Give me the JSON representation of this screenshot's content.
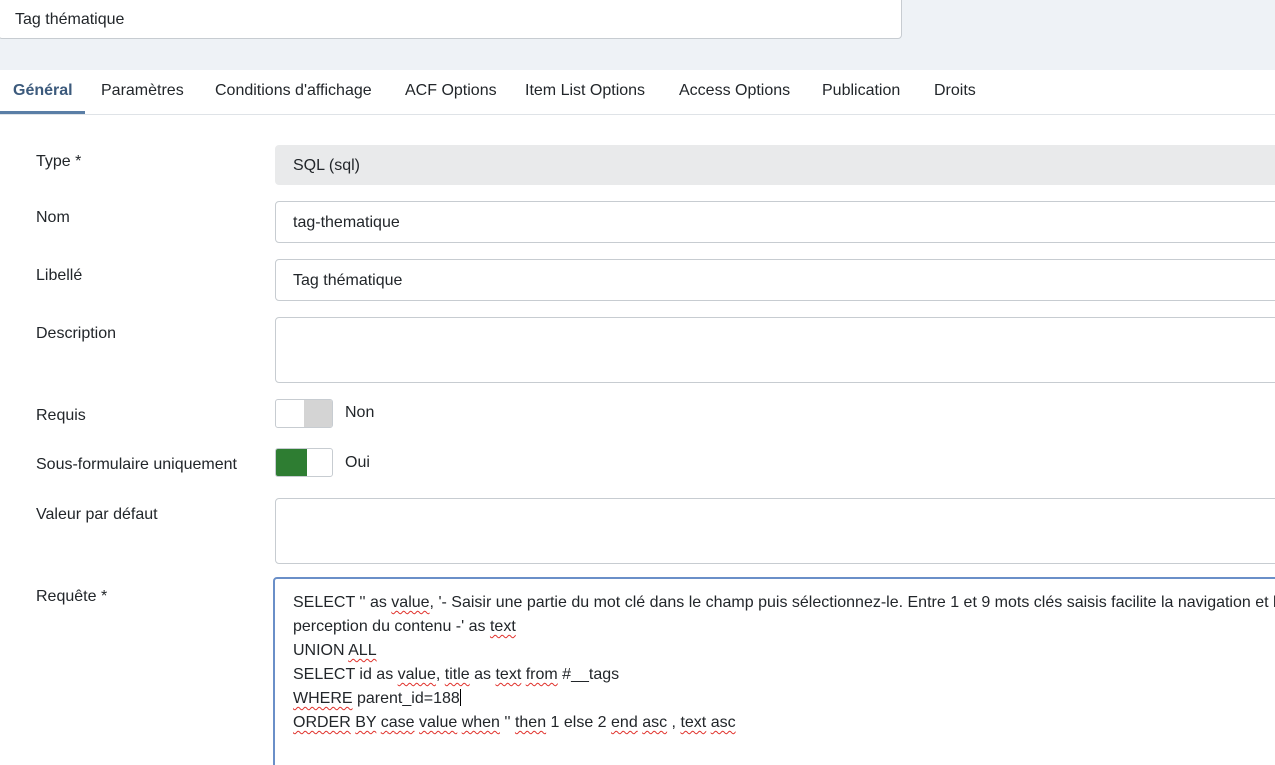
{
  "header": {
    "title_value": "Tag thématique"
  },
  "tabs": [
    {
      "label": "Général",
      "active": true
    },
    {
      "label": "Paramètres"
    },
    {
      "label": "Conditions d'affichage"
    },
    {
      "label": "ACF Options"
    },
    {
      "label": "Item List Options"
    },
    {
      "label": "Access Options"
    },
    {
      "label": "Publication"
    },
    {
      "label": "Droits"
    }
  ],
  "form": {
    "type": {
      "label": "Type *",
      "value": "SQL (sql)"
    },
    "name": {
      "label": "Nom",
      "value": "tag-thematique"
    },
    "label": {
      "label": "Libellé",
      "value": "Tag thématique"
    },
    "description": {
      "label": "Description",
      "value": ""
    },
    "required": {
      "label": "Requis",
      "state": "Non"
    },
    "subform_only": {
      "label": "Sous-formulaire uniquement",
      "state": "Oui"
    },
    "default_value": {
      "label": "Valeur par défaut",
      "value": ""
    },
    "query": {
      "label": "Requête *",
      "lines": [
        "SELECT '' as value, '- Saisir une partie du mot clé dans le champ puis sélectionnez-le. Entre 1 et 9 mots clés saisis facilite la navigation et la",
        "perception du contenu -' as text",
        "UNION ALL",
        "SELECT id as value, title as text from #__tags",
        "WHERE parent_id=188",
        "ORDER BY case value when '' then 1 else 2 end asc , text asc"
      ]
    }
  },
  "colors": {
    "accent": "#5a7ea6",
    "toggle_on": "#2e7d32",
    "toggle_off": "#d4d4d4",
    "focus_border": "#6a8fc8"
  }
}
